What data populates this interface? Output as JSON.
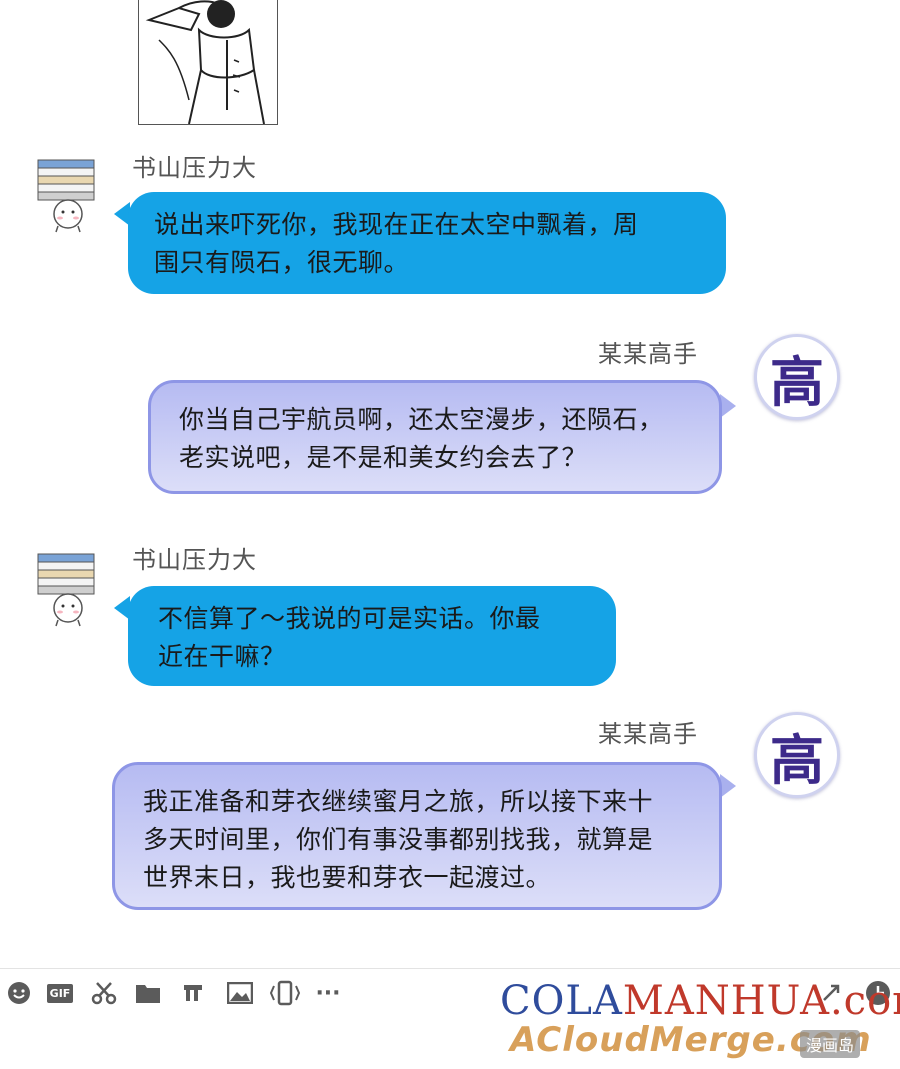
{
  "messages": [
    {
      "sender": "书山压力大",
      "side": "left",
      "lines": [
        "说出来吓死你，我现在正在太空中飘着，周",
        "围只有陨石，很无聊。"
      ]
    },
    {
      "sender": "某某高手",
      "side": "right",
      "avatar_char": "高",
      "lines": [
        "你当自己宇航员啊，还太空漫步，还陨石，",
        "老实说吧，是不是和美女约会去了？"
      ]
    },
    {
      "sender": "书山压力大",
      "side": "left",
      "lines": [
        "不信算了～我说的可是实话。你最",
        "近在干嘛？"
      ]
    },
    {
      "sender": "某某高手",
      "side": "right",
      "avatar_char": "高",
      "lines": [
        "我正准备和芽衣继续蜜月之旅，所以接下来十",
        "多天时间里，你们有事没事都别找我，就算是",
        "世界末日，我也要和芽衣一起渡过。"
      ]
    }
  ],
  "toolbar": {
    "icons": [
      "smiley-icon",
      "gif-icon",
      "scissors-icon",
      "folder-icon",
      "music-icon",
      "image-icon",
      "shake-icon",
      "more-icon",
      "expand-icon",
      "clock-icon"
    ],
    "gif_label": "GIF",
    "more_label": "···"
  },
  "watermark": {
    "line1_a": "COLA",
    "line1_b": "MANHUA.com",
    "line2": "ACloudMerge.com",
    "badge": "漫画岛"
  },
  "colors": {
    "left_bubble": "#15a3e6",
    "right_bubble": "#c4c8f4",
    "right_border": "#8e96e6",
    "avatar_text": "#3d2a8a"
  }
}
